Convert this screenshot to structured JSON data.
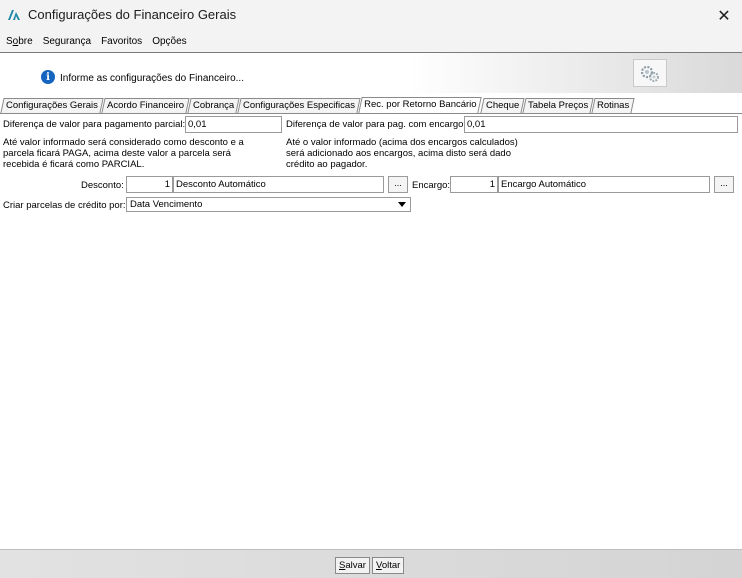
{
  "window": {
    "title": "Configurações do Financeiro Gerais",
    "close_glyph": "✕"
  },
  "menu": [
    "Sobre",
    "Segurança",
    "Favoritos",
    "Opções"
  ],
  "info": {
    "text": "Informe as configurações do Financeiro...",
    "icon_glyph": "i"
  },
  "tabs": [
    "Configurações Gerais",
    "Acordo Financeiro",
    "Cobrança",
    "Configurações Especificas",
    "Rec. por Retorno Bancário",
    "Cheque",
    "Tabela Preços",
    "Rotinas"
  ],
  "active_tab_index": 4,
  "form": {
    "partial_label": "Diferença de valor para pagamento parcial:",
    "partial_value": "0,01",
    "charge_label": "Diferença de valor para pag. com encargo:",
    "charge_value": "0,01",
    "partial_desc": [
      "Até valor informado será considerado como desconto e a",
      "parcela ficará PAGA, acima deste valor a parcela será",
      "recebida é ficará como PARCIAL."
    ],
    "charge_desc": [
      "Até o valor informado (acima dos encargos calculados)",
      "será adicionado aos encargos, acima disto será dado",
      "crédito ao pagador."
    ],
    "discount_label": "Desconto:",
    "discount_code": "1",
    "discount_name": "Desconto Automático",
    "charge2_label": "Encargo:",
    "charge2_code": "1",
    "charge2_name": "Encargo Automático",
    "browse_label": "...",
    "credit_label": "Criar parcelas de crédito por:",
    "credit_value": "Data Vencimento"
  },
  "footer": {
    "save_label": "Salvar",
    "back_label": "Voltar"
  },
  "colors": {
    "info_icon": "#1565c0",
    "logo": "#1e88a8"
  }
}
